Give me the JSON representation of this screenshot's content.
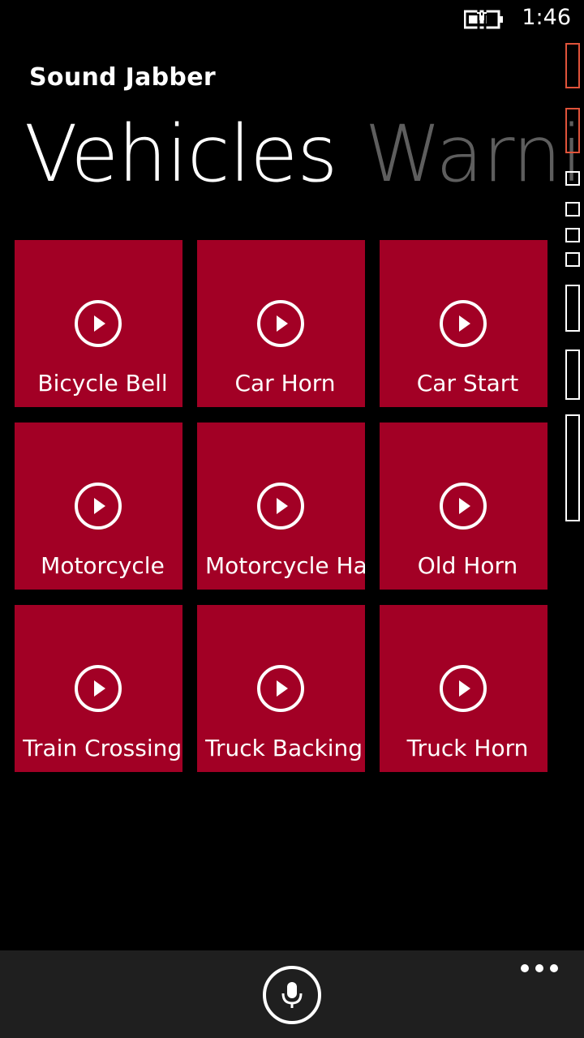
{
  "status_bar": {
    "time": "1:46"
  },
  "app": {
    "title": "Sound Jabber"
  },
  "pivot": {
    "items": [
      "Vehicles",
      "Warni"
    ]
  },
  "tiles": [
    {
      "label": "Bicycle Bell"
    },
    {
      "label": "Car Horn"
    },
    {
      "label": "Car Start"
    },
    {
      "label": "Motorcycle"
    },
    {
      "label": "Motorcycle Har"
    },
    {
      "label": "Old Horn"
    },
    {
      "label": "Train Crossing"
    },
    {
      "label": "Truck Backing U"
    },
    {
      "label": "Truck Horn"
    }
  ],
  "colors": {
    "tile": "#a20025",
    "inactive_pivot": "#5e5e5e",
    "app_bar": "#1f1f1f"
  },
  "icons": {
    "tile_icon": "play-circle-icon",
    "app_bar_button": "microphone-icon",
    "more": "ellipsis-icon"
  }
}
